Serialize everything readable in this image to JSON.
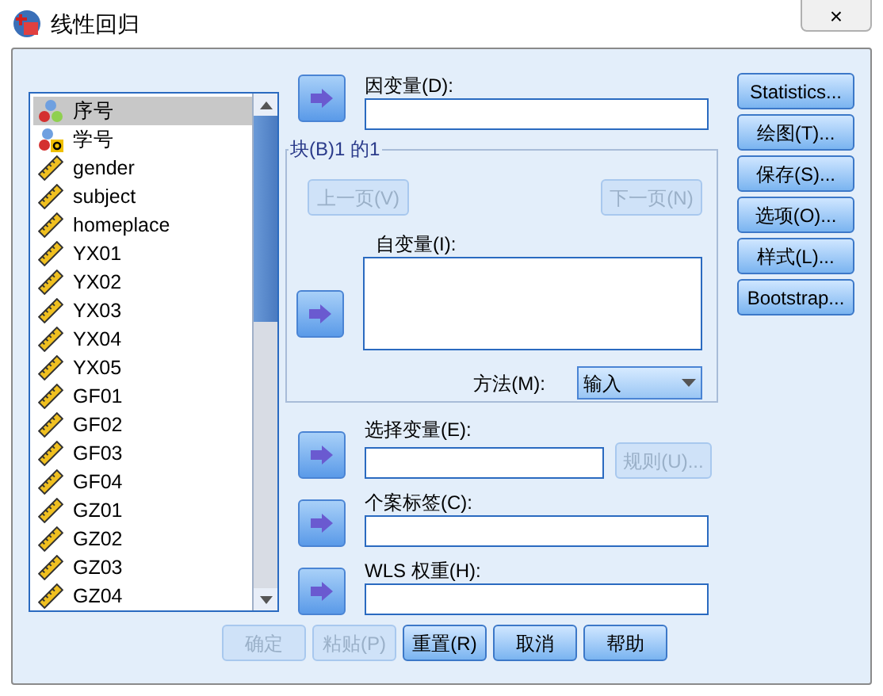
{
  "window": {
    "title": "线性回归",
    "close": "×"
  },
  "variables": [
    {
      "label": "序号",
      "kind": "nominal",
      "selected": true
    },
    {
      "label": "学号",
      "kind": "string",
      "selected": false
    },
    {
      "label": "gender",
      "kind": "scale",
      "selected": false
    },
    {
      "label": "subject",
      "kind": "scale",
      "selected": false
    },
    {
      "label": "homeplace",
      "kind": "scale",
      "selected": false
    },
    {
      "label": "YX01",
      "kind": "scale",
      "selected": false
    },
    {
      "label": "YX02",
      "kind": "scale",
      "selected": false
    },
    {
      "label": "YX03",
      "kind": "scale",
      "selected": false
    },
    {
      "label": "YX04",
      "kind": "scale",
      "selected": false
    },
    {
      "label": "YX05",
      "kind": "scale",
      "selected": false
    },
    {
      "label": "GF01",
      "kind": "scale",
      "selected": false
    },
    {
      "label": "GF02",
      "kind": "scale",
      "selected": false
    },
    {
      "label": "GF03",
      "kind": "scale",
      "selected": false
    },
    {
      "label": "GF04",
      "kind": "scale",
      "selected": false
    },
    {
      "label": "GZ01",
      "kind": "scale",
      "selected": false
    },
    {
      "label": "GZ02",
      "kind": "scale",
      "selected": false
    },
    {
      "label": "GZ03",
      "kind": "scale",
      "selected": false
    },
    {
      "label": "GZ04",
      "kind": "scale",
      "selected": false
    }
  ],
  "dependent": {
    "label": "因变量(D):"
  },
  "block": {
    "title": "块(B)1 的1",
    "previous": {
      "label": "上一页(V)",
      "disabled": true
    },
    "next": {
      "label": "下一页(N)",
      "disabled": true
    },
    "independents_label": "自变量(I):",
    "method_label": "方法(M):",
    "method_value": "输入"
  },
  "selection": {
    "label": "选择变量(E):",
    "rule": {
      "label": "规则(U)...",
      "disabled": true
    }
  },
  "case_labels": {
    "label": "个案标签(C):"
  },
  "wls_weight": {
    "label": "WLS 权重(H):"
  },
  "side_buttons": [
    {
      "label": "Statistics..."
    },
    {
      "label": "绘图(T)..."
    },
    {
      "label": "保存(S)..."
    },
    {
      "label": "选项(O)..."
    },
    {
      "label": "样式(L)..."
    },
    {
      "label": "Bootstrap..."
    }
  ],
  "bottom_buttons": [
    {
      "label": "确定",
      "disabled": true
    },
    {
      "label": "粘贴(P)",
      "disabled": true
    },
    {
      "label": "重置(R)",
      "disabled": false
    },
    {
      "label": "取消",
      "disabled": false
    },
    {
      "label": "帮助",
      "disabled": false
    }
  ]
}
